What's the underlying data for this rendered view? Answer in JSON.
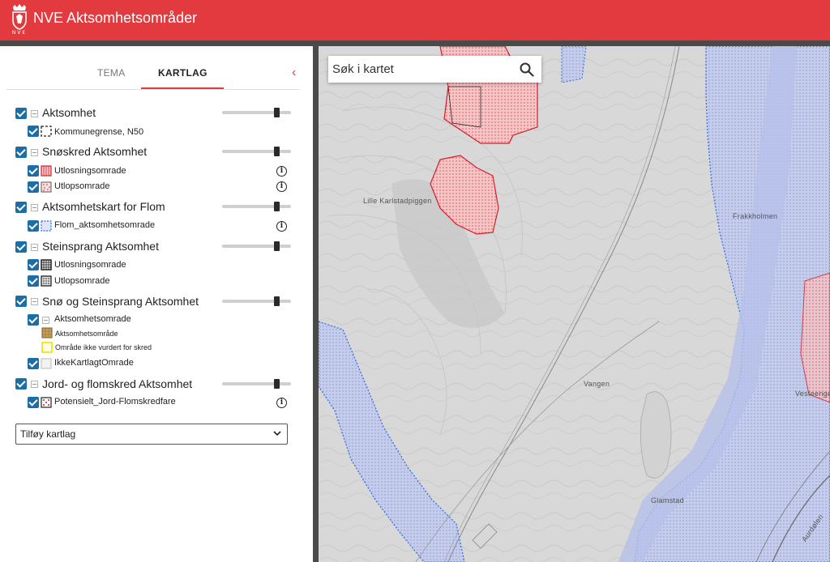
{
  "app": {
    "title": "NVE Aktsomhetsområder",
    "logo_text": "NVE"
  },
  "colors": {
    "brand_red": "#e33a40",
    "checkbox_blue": "#1b6ea6"
  },
  "tabs": [
    {
      "label": "TEMA",
      "active": false
    },
    {
      "label": "KARTLAG",
      "active": true
    }
  ],
  "layers": [
    {
      "label": "Aktsomhet",
      "checked": true,
      "opacity": 0.85,
      "children": [
        {
          "label": "Kommunegrense, N50",
          "icon": "boundary-legend",
          "info": false
        }
      ]
    },
    {
      "label": "Snøskred Aktsomhet",
      "checked": true,
      "opacity": 0.85,
      "children": [
        {
          "label": "Utlosningsomrade",
          "icon": "red-hatch-legend",
          "info": true
        },
        {
          "label": "Utlopsomrade",
          "icon": "red-dots-legend",
          "info": true
        }
      ]
    },
    {
      "label": "Aktsomhetskart for Flom",
      "checked": true,
      "opacity": 0.85,
      "children": [
        {
          "label": "Flom_aktsomhetsomrade",
          "icon": "blue-dots-legend",
          "info": true
        }
      ]
    },
    {
      "label": "Steinsprang Aktsomhet",
      "checked": true,
      "opacity": 0.85,
      "children": [
        {
          "label": "Utlosningsomrade",
          "icon": "black-hatch-legend",
          "info": false
        },
        {
          "label": "Utlopsomrade",
          "icon": "black-dots-legend",
          "info": false
        }
      ]
    },
    {
      "label": "Snø og Steinsprang Aktsomhet",
      "checked": true,
      "opacity": 0.85,
      "children": [
        {
          "label": "Aktsomhetsomrade",
          "checked": true,
          "legend": [
            {
              "label": "Aktsomhetsområde",
              "icon": "brown-fill-legend"
            },
            {
              "label": "Område ikke vurdert for skred",
              "icon": "yellow-outline-legend"
            }
          ]
        },
        {
          "label": "IkkeKartlagtOmrade",
          "icon": "grey-box-legend",
          "info": false
        }
      ]
    },
    {
      "label": "Jord- og flomskred Aktsomhet",
      "checked": true,
      "opacity": 0.85,
      "children": [
        {
          "label": "Potensielt_Jord-Flomskredfare",
          "icon": "red-dots-legend",
          "info": true
        }
      ]
    }
  ],
  "add_layer": {
    "selected": "Tilføy kartlag"
  },
  "search": {
    "placeholder": "Søk i kartet"
  },
  "map_labels": [
    "Lille Karlstadpiggen",
    "Frakkholmen",
    "Vangen",
    "Vesteenget",
    "Glamstad",
    "Aurdølen"
  ]
}
